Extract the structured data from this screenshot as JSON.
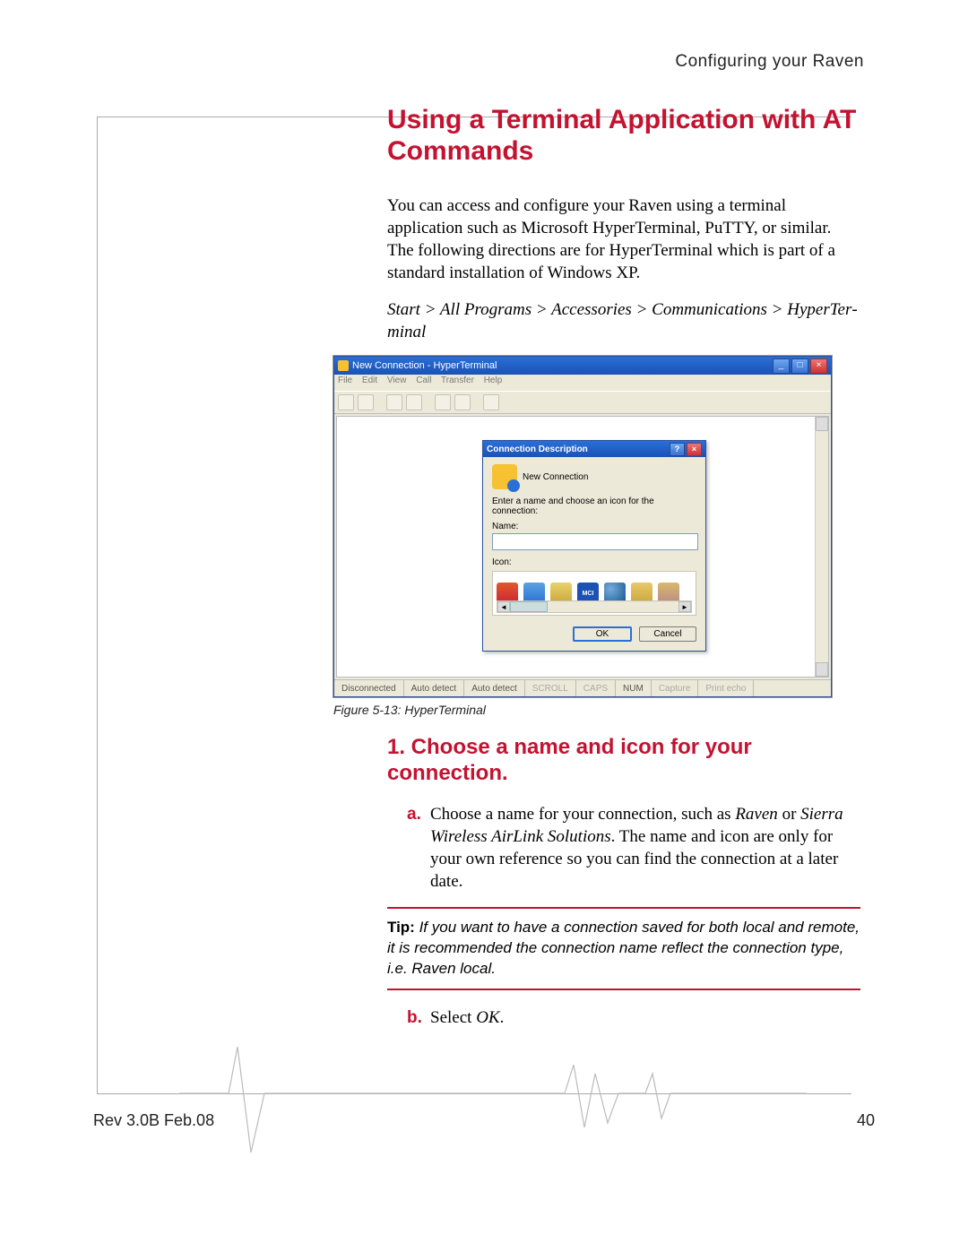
{
  "running_header": "Configuring your Raven",
  "heading_main": "Using a Terminal Application with AT Commands",
  "para_intro": "You can access and configure your Raven using a terminal application such as Microsoft HyperTerminal, PuTTY, or similar. The following directions are for HyperTerminal which is part of a standard installation of Windows XP.",
  "nav_path": "Start > All Programs > Accessories > Communications > HyperTer­minal",
  "figure_caption": "Figure 5-13: HyperTerminal",
  "step1_heading": "1. Choose a name and icon for your connection.",
  "step1_a_pre": "Choose a name for your connection, such as ",
  "step1_a_em1": "Raven",
  "step1_a_mid": " or ",
  "step1_a_em2": "Sierra Wireless AirLink Solutions",
  "step1_a_post": ". The name and icon are only for your own reference so you can find the connection at a later date.",
  "tip_label": "Tip: ",
  "tip_text": "If you want to have a connection saved for both local and remote, it is recommended the connection name reflect the connection type, i.e. Raven local.",
  "step1_b_pre": "Select ",
  "step1_b_em": "OK",
  "step1_b_post": ".",
  "footer_left": "Rev 3.0B  Feb.08",
  "footer_right": "40",
  "ht": {
    "window_title": "New Connection - HyperTerminal",
    "menu": {
      "file": "File",
      "edit": "Edit",
      "view": "View",
      "call": "Call",
      "transfer": "Transfer",
      "help": "Help"
    },
    "dialog": {
      "title": "Connection Description",
      "new_conn": "New Connection",
      "instr": "Enter a name and choose an icon for the connection:",
      "name_label": "Name:",
      "icon_label": "Icon:",
      "mci": "MCI",
      "ok": "OK",
      "cancel": "Cancel"
    },
    "status": {
      "s1": "Disconnected",
      "s2": "Auto detect",
      "s3": "Auto detect",
      "s4": "SCROLL",
      "s5": "CAPS",
      "s6": "NUM",
      "s7": "Capture",
      "s8": "Print echo"
    }
  }
}
